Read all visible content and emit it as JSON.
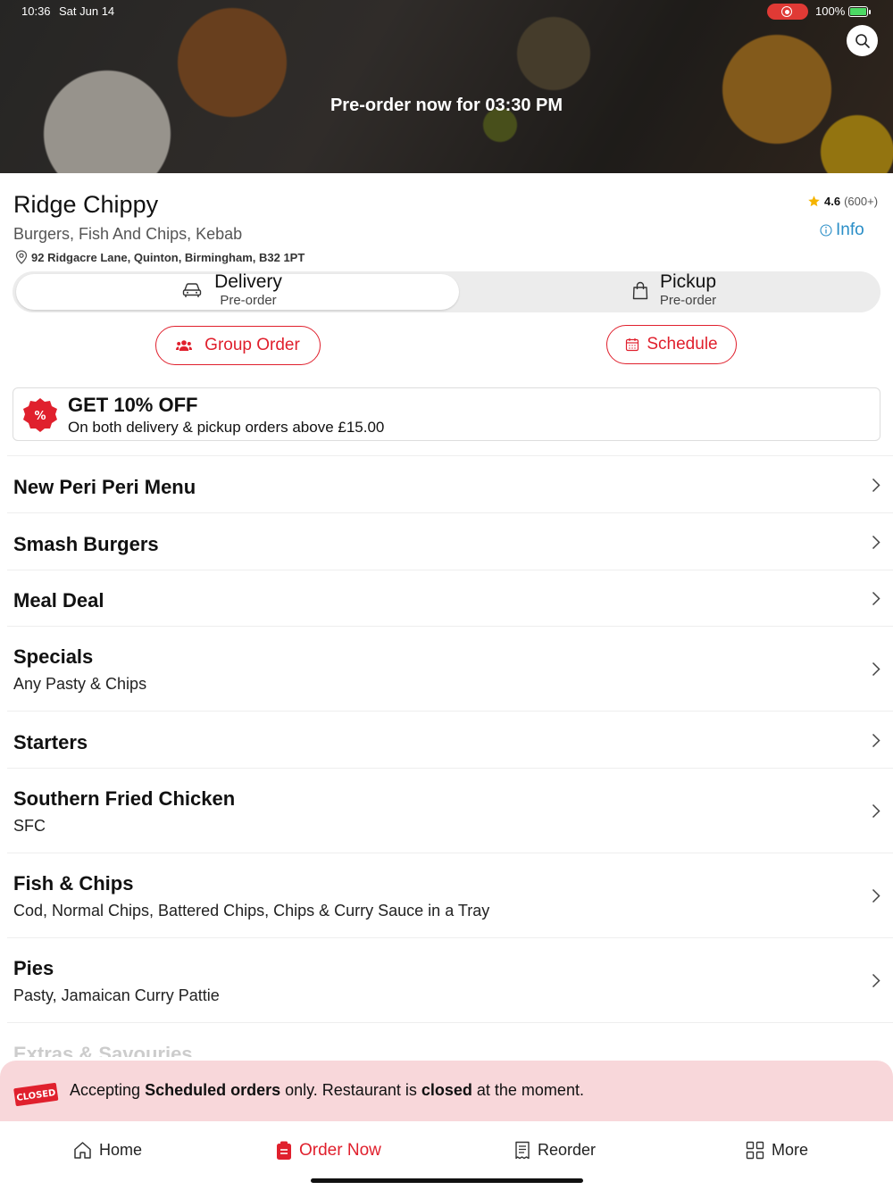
{
  "status_bar": {
    "time": "10:36",
    "date": "Sat Jun 14",
    "battery": "100%"
  },
  "hero": {
    "preorder_text": "Pre-order now for 03:30 PM"
  },
  "restaurant": {
    "name": "Ridge Chippy",
    "cuisine": "Burgers, Fish And Chips, Kebab",
    "address": "92 Ridgacre Lane, Quinton, Birmingham, B32 1PT",
    "rating": "4.6",
    "rating_count": "(600+)",
    "info_label": "Info"
  },
  "order_mode": {
    "delivery": {
      "label": "Delivery",
      "sub": "Pre-order",
      "selected": true
    },
    "pickup": {
      "label": "Pickup",
      "sub": "Pre-order",
      "selected": false
    }
  },
  "actions": {
    "group_order": "Group Order",
    "schedule": "Schedule"
  },
  "offer": {
    "title": "GET 10% OFF",
    "subtitle": "On both delivery & pickup orders above £15.00"
  },
  "menu": [
    {
      "name": "New Peri Peri Menu",
      "desc": ""
    },
    {
      "name": "Smash Burgers",
      "desc": ""
    },
    {
      "name": "Meal Deal",
      "desc": ""
    },
    {
      "name": "Specials",
      "desc": "Any Pasty & Chips"
    },
    {
      "name": "Starters",
      "desc": ""
    },
    {
      "name": "Southern Fried Chicken",
      "desc": "SFC"
    },
    {
      "name": "Fish & Chips",
      "desc": "Cod, Normal Chips, Battered Chips, Chips & Curry Sauce in a Tray"
    },
    {
      "name": "Pies",
      "desc": "Pasty, Jamaican Curry Pattie"
    },
    {
      "name": "Extras & Savouries",
      "desc": ""
    }
  ],
  "closed_banner": {
    "badge": "CLOSED",
    "part1": "Accepting ",
    "bold1": "Scheduled orders",
    "part2": " only. Restaurant is ",
    "bold2": "closed",
    "part3": " at the moment."
  },
  "bottom_nav": {
    "home": "Home",
    "order_now": "Order Now",
    "reorder": "Reorder",
    "more": "More"
  },
  "colors": {
    "accent": "#e0202d",
    "link": "#2a8ec7",
    "closed_bg": "#f8d7da"
  }
}
